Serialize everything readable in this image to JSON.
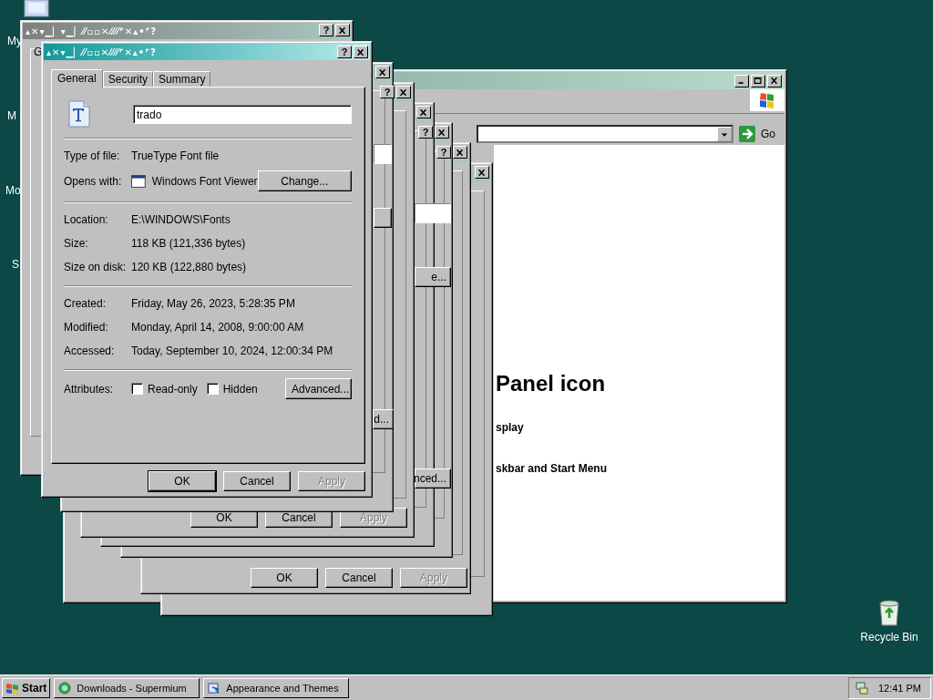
{
  "desktop": {
    "icons": [
      {
        "label": "My"
      },
      {
        "label": "M"
      },
      {
        "label": "Mo"
      },
      {
        "label": "S"
      }
    ],
    "recycle_bin": {
      "label": "Recycle Bin"
    }
  },
  "browser_window": {
    "go_button": "Go",
    "heading": "Panel icon",
    "links": [
      "splay",
      "skbar and Start Menu"
    ]
  },
  "back_dialogs": [
    {
      "title": "▴✕▾▁▏▾▁▏⁄⁄▫▫✕⁄⁄⁄⁄⌜✕▴•⌜?",
      "help": "?",
      "tab": "G"
    },
    {
      "help": false,
      "fragments": [
        {
          "kind": "field"
        },
        {
          "kind": "button"
        },
        {
          "kind": "button",
          "label": "d..."
        }
      ]
    },
    {
      "help": "?",
      "buttons": [
        {
          "label": "OK",
          "disabled": false
        },
        {
          "label": "Cancel",
          "disabled": false
        },
        {
          "label": "Apply",
          "disabled": true
        }
      ]
    },
    {
      "help": false
    },
    {
      "help": "?",
      "fragments": [
        {
          "kind": "field"
        },
        {
          "kind": "button",
          "label": "e..."
        },
        {
          "kind": "button",
          "label": "nced..."
        }
      ]
    },
    {
      "help": "?",
      "buttons": [
        {
          "label": "OK",
          "disabled": false
        },
        {
          "label": "Cancel",
          "disabled": false
        },
        {
          "label": "Apply",
          "disabled": true
        }
      ]
    },
    {
      "help": false
    }
  ],
  "dialog": {
    "title": "▴✕▾▁▏⁄⁄▫▫✕⁄⁄⁄⁄⌜✕▴•⌜?",
    "help": "?",
    "tabs": [
      {
        "label": "General",
        "selected": true
      },
      {
        "label": "Security",
        "selected": false
      },
      {
        "label": "Summary",
        "selected": false
      }
    ],
    "file_name": "trado",
    "sections": [
      [
        {
          "kind": "text",
          "label": "Type of file:",
          "value": "TrueType Font file"
        },
        {
          "kind": "app",
          "label": "Opens with:",
          "value": "Windows Font Viewer",
          "button": "Change..."
        }
      ],
      [
        {
          "kind": "text",
          "label": "Location:",
          "value": "E:\\WINDOWS\\Fonts"
        },
        {
          "kind": "text",
          "label": "Size:",
          "value": "118 KB (121,336 bytes)"
        },
        {
          "kind": "text",
          "label": "Size on disk:",
          "value": "120 KB (122,880 bytes)"
        }
      ],
      [
        {
          "kind": "text",
          "label": "Created:",
          "value": "Friday, May 26, 2023, 5:28:35 PM"
        },
        {
          "kind": "text",
          "label": "Modified:",
          "value": "Monday, April 14, 2008, 9:00:00 AM"
        },
        {
          "kind": "text",
          "label": "Accessed:",
          "value": "Today, September 10, 2024, 12:00:34 PM"
        }
      ]
    ],
    "attributes": {
      "label": "Attributes:",
      "checkboxes": [
        {
          "label": "Read-only",
          "checked": false
        },
        {
          "label": "Hidden",
          "checked": false
        }
      ],
      "button": "Advanced..."
    },
    "buttons": [
      {
        "label": "OK",
        "disabled": false
      },
      {
        "label": "Cancel",
        "disabled": false
      },
      {
        "label": "Apply",
        "disabled": true
      }
    ]
  },
  "taskbar": {
    "start": "Start",
    "tasks": [
      {
        "label": "Downloads - Supermium",
        "selected": false
      },
      {
        "label": "Appearance and Themes",
        "selected": false
      }
    ],
    "clock": "12:41 PM"
  }
}
